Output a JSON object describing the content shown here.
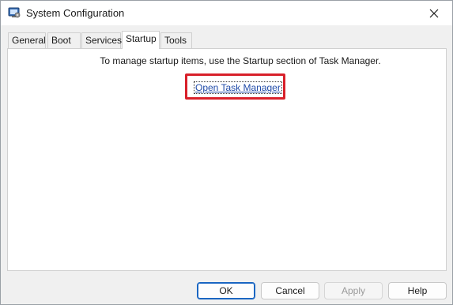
{
  "window": {
    "title": "System Configuration"
  },
  "tabs": [
    {
      "label": "General"
    },
    {
      "label": "Boot"
    },
    {
      "label": "Services"
    },
    {
      "label": "Startup"
    },
    {
      "label": "Tools"
    }
  ],
  "active_tab": "Startup",
  "startup": {
    "info_text": "To manage startup items, use the Startup section of Task Manager.",
    "link_text": "Open Task Manager"
  },
  "buttons": {
    "ok": "OK",
    "cancel": "Cancel",
    "apply": "Apply",
    "help": "Help"
  },
  "colors": {
    "highlight": "#d8202a",
    "link": "#1f4aa8",
    "primary_border": "#1a66c2"
  }
}
